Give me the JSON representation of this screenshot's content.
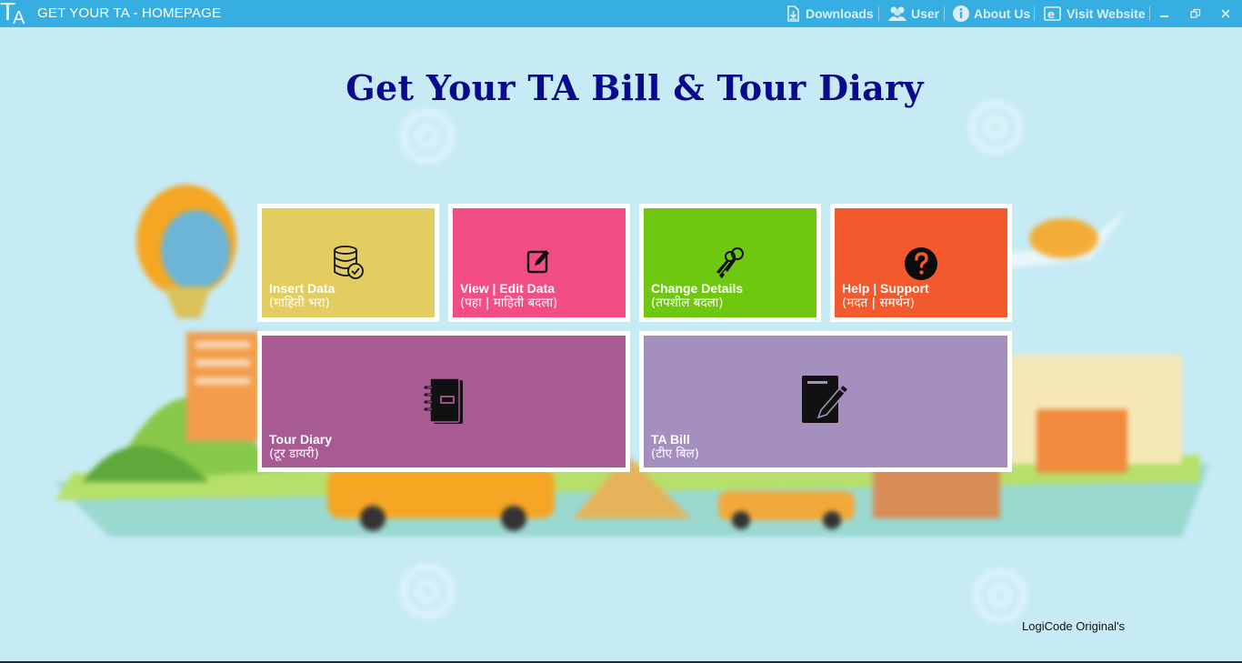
{
  "window": {
    "logo_letters": "TA",
    "title": "GET YOUR TA - HOMEPAGE",
    "menu": [
      {
        "label": "Downloads",
        "icon": "download-icon"
      },
      {
        "label": "User",
        "icon": "users-icon"
      },
      {
        "label": "About Us",
        "icon": "info-icon"
      },
      {
        "label": "Visit Website",
        "icon": "browser-icon"
      }
    ],
    "controls": [
      "minimize-icon",
      "restore-icon",
      "close-icon"
    ],
    "colors": {
      "titlebar": "#37aee2",
      "background": "#c6ebf5"
    }
  },
  "heading": "Get Your TA Bill & Tour Diary",
  "tiles": [
    {
      "title": "Insert Data",
      "subtitle": "(माहिती भरा)",
      "icon": "database-check-icon",
      "color": "#e3cd61"
    },
    {
      "title": "View | Edit Data",
      "subtitle": "(पहा | माहिती बदला)",
      "icon": "edit-icon",
      "color": "#f24d84"
    },
    {
      "title": "Change Details",
      "subtitle": "(तपशील बदला)",
      "icon": "keys-icon",
      "color": "#6fc80f"
    },
    {
      "title": "Help | Support",
      "subtitle": "(मदत | समर्थन)",
      "icon": "question-circle-icon",
      "color": "#f25a2e"
    },
    {
      "title": "Tour Diary",
      "subtitle": "(टूर डायरी)",
      "icon": "notebook-icon",
      "color": "#a85a93"
    },
    {
      "title": "TA Bill",
      "subtitle": "(टीए बिल)",
      "icon": "document-pen-icon",
      "color": "#a48fbf"
    }
  ],
  "footer": {
    "credit": "LogiCode Original's"
  }
}
